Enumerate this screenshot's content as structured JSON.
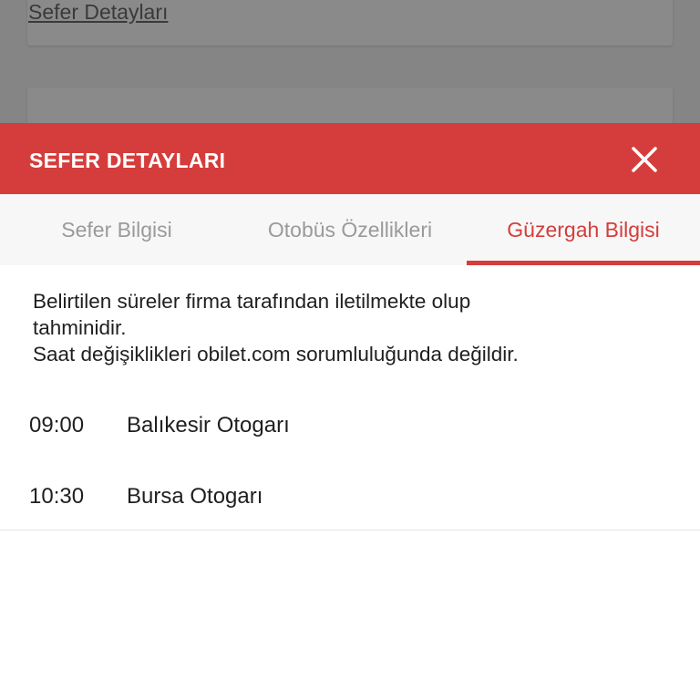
{
  "background": {
    "link_text": "Sefer Detayları"
  },
  "sheet": {
    "title": "SEFER DETAYLARI",
    "close_icon": "close-icon",
    "accent_color": "#d43d3b"
  },
  "tabs": [
    {
      "label": "Sefer Bilgisi",
      "active": false
    },
    {
      "label": "Otobüs Özellikleri",
      "active": false
    },
    {
      "label": "Güzergah Bilgisi",
      "active": true
    }
  ],
  "route": {
    "notice_lines": [
      "Belirtilen süreler firma tarafından iletilmekte olup",
      "tahminidir.",
      "Saat değişiklikleri obilet.com sorumluluğunda değildir."
    ],
    "stops": [
      {
        "time": "09:00",
        "name": "Balıkesir Otogarı"
      },
      {
        "time": "10:30",
        "name": "Bursa Otogarı"
      }
    ]
  }
}
